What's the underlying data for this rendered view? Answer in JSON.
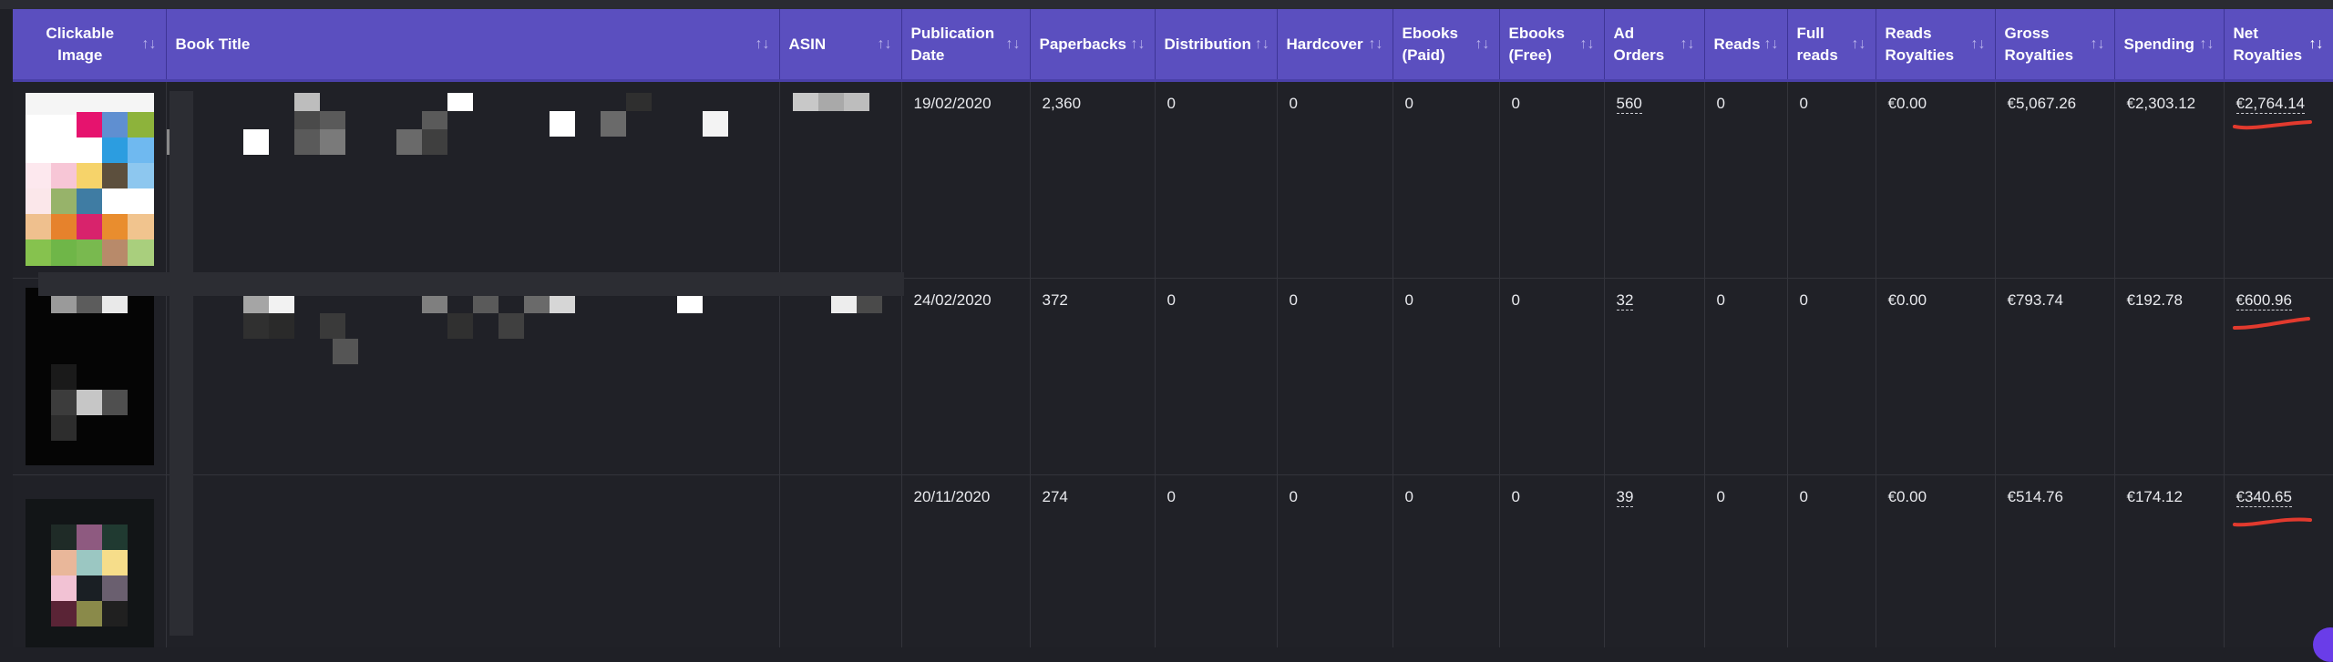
{
  "table": {
    "columns": [
      {
        "label": "Clickable Image",
        "sort_icon": "sort-icon"
      },
      {
        "label": "Book Title",
        "sort_icon": "sort-icon"
      },
      {
        "label": "ASIN",
        "sort_icon": "sort-icon"
      },
      {
        "label": "Publication Date",
        "sort_icon": "sort-icon"
      },
      {
        "label": "Paperbacks",
        "sort_icon": "sort-icon"
      },
      {
        "label": "Distribution",
        "sort_icon": "sort-icon"
      },
      {
        "label": "Hardcover",
        "sort_icon": "sort-icon"
      },
      {
        "label": "Ebooks (Paid)",
        "sort_icon": "sort-icon"
      },
      {
        "label": "Ebooks (Free)",
        "sort_icon": "sort-icon"
      },
      {
        "label": "Ad Orders",
        "sort_icon": "sort-icon"
      },
      {
        "label": "Reads",
        "sort_icon": "sort-icon"
      },
      {
        "label": "Full reads",
        "sort_icon": "sort-icon"
      },
      {
        "label": "Reads Royalties",
        "sort_icon": "sort-icon"
      },
      {
        "label": "Gross Royalties",
        "sort_icon": "sort-icon"
      },
      {
        "label": "Spending",
        "sort_icon": "sort-icon"
      },
      {
        "label": "Net Royalties",
        "sort_icon": "sort-down-icon"
      }
    ],
    "rows": [
      {
        "publication_date": "19/02/2020",
        "paperbacks": "2,360",
        "distribution": "0",
        "hardcover": "0",
        "ebooks_paid": "0",
        "ebooks_free": "0",
        "ad_orders": "560",
        "reads": "0",
        "full_reads": "0",
        "reads_royalties": "€0.00",
        "gross_royalties": "€5,067.26",
        "spending": "€2,303.12",
        "net_royalties": "€2,764.14"
      },
      {
        "publication_date": "24/02/2020",
        "paperbacks": "372",
        "distribution": "0",
        "hardcover": "0",
        "ebooks_paid": "0",
        "ebooks_free": "0",
        "ad_orders": "32",
        "reads": "0",
        "full_reads": "0",
        "reads_royalties": "€0.00",
        "gross_royalties": "€793.74",
        "spending": "€192.78",
        "net_royalties": "€600.96"
      },
      {
        "publication_date": "20/11/2020",
        "paperbacks": "274",
        "distribution": "0",
        "hardcover": "0",
        "ebooks_paid": "0",
        "ebooks_free": "0",
        "ad_orders": "39",
        "reads": "0",
        "full_reads": "0",
        "reads_royalties": "€0.00",
        "gross_royalties": "€514.76",
        "spending": "€174.12",
        "net_royalties": "€340.65"
      }
    ]
  },
  "colors": {
    "header_bg": "#5b4fbf",
    "row_bg": "#202127",
    "annotation_red": "#e23a2e",
    "fab": "#6a3de8"
  }
}
